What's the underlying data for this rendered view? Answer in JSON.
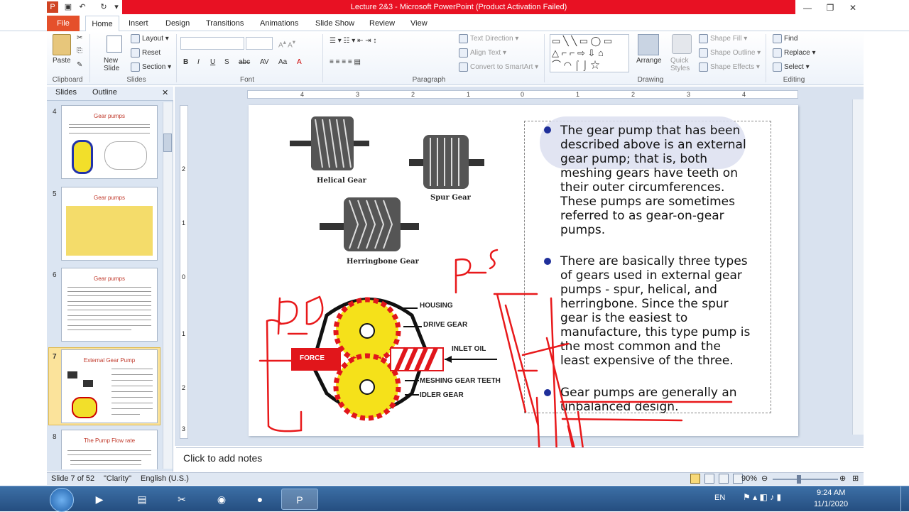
{
  "app": {
    "window_title": "Lecture 2&3  -  Microsoft PowerPoint (Product Activation Failed)"
  },
  "tabs": [
    "File",
    "Home",
    "Insert",
    "Design",
    "Transitions",
    "Animations",
    "Slide Show",
    "Review",
    "View"
  ],
  "ribbon": {
    "clipboard": {
      "paste": "Paste",
      "label": "Clipboard"
    },
    "slides": {
      "new_slide": "New Slide",
      "layout": "Layout",
      "reset": "Reset",
      "section": "Section",
      "label": "Slides"
    },
    "font": {
      "label": "Font"
    },
    "paragraph": {
      "text_direction": "Text Direction",
      "align_text": "Align Text",
      "convert": "Convert to SmartArt",
      "label": "Paragraph"
    },
    "drawing": {
      "arrange": "Arrange",
      "quick_styles": "Quick Styles",
      "shape_fill": "Shape Fill",
      "shape_outline": "Shape Outline",
      "shape_effects": "Shape Effects",
      "label": "Drawing"
    },
    "editing": {
      "find": "Find",
      "replace": "Replace",
      "select": "Select",
      "label": "Editing"
    }
  },
  "panel": {
    "tabs": [
      "Slides",
      "Outline"
    ],
    "slides": [
      {
        "num": "4",
        "title": "Gear pumps"
      },
      {
        "num": "5",
        "title": "Gear pumps"
      },
      {
        "num": "6",
        "title": "Gear pumps"
      },
      {
        "num": "7",
        "title": "External Gear Pump"
      },
      {
        "num": "8",
        "title": "The Pump Flow rate"
      }
    ]
  },
  "ruler": {
    "h_ticks": [
      "4",
      "3",
      "2",
      "1",
      "0",
      "1",
      "2",
      "3",
      "4"
    ],
    "v_ticks": [
      "2",
      "1",
      "0",
      "1",
      "2",
      "3"
    ]
  },
  "slide": {
    "gear_labels": {
      "helical": "Helical Gear",
      "spur": "Spur Gear",
      "herringbone": "Herringbone Gear"
    },
    "diagram_labels": {
      "housing": "HOUSING",
      "drive_gear": "DRIVE GEAR",
      "force": "FORCE",
      "inlet_oil": "INLET OIL",
      "meshing": "MESHING GEAR TEETH",
      "idler": "IDLER GEAR"
    },
    "bullets": [
      "The gear pump that has been described above is an external gear pump; that is, both meshing gears have teeth on their outer circumferences. These pumps are sometimes referred to as gear-on-gear pumps.",
      "There are basically three types of gears used in external gear pumps - spur, helical, and herringbone. Since the spur gear is the easiest to manufacture, this type pump is the most common and the least expensive of the three.",
      "Gear pumps are generally an unbalanced design."
    ],
    "annotations": {
      "pd": "P-D",
      "ps": "P-S"
    }
  },
  "notes": {
    "placeholder": "Click to add notes"
  },
  "status": {
    "slide": "Slide 7 of 52",
    "theme": "\"Clarity\"",
    "language": "English (U.S.)",
    "zoom": "90%"
  },
  "taskbar": {
    "time": "9:24 AM",
    "date": "11/1/2020",
    "lang": "EN"
  },
  "colors": {
    "title_bar": "#e81123",
    "file_tab": "#e5502b",
    "bullet": "#1f2f9a",
    "ink": "#e8191b",
    "gear": "#f5e11a"
  }
}
